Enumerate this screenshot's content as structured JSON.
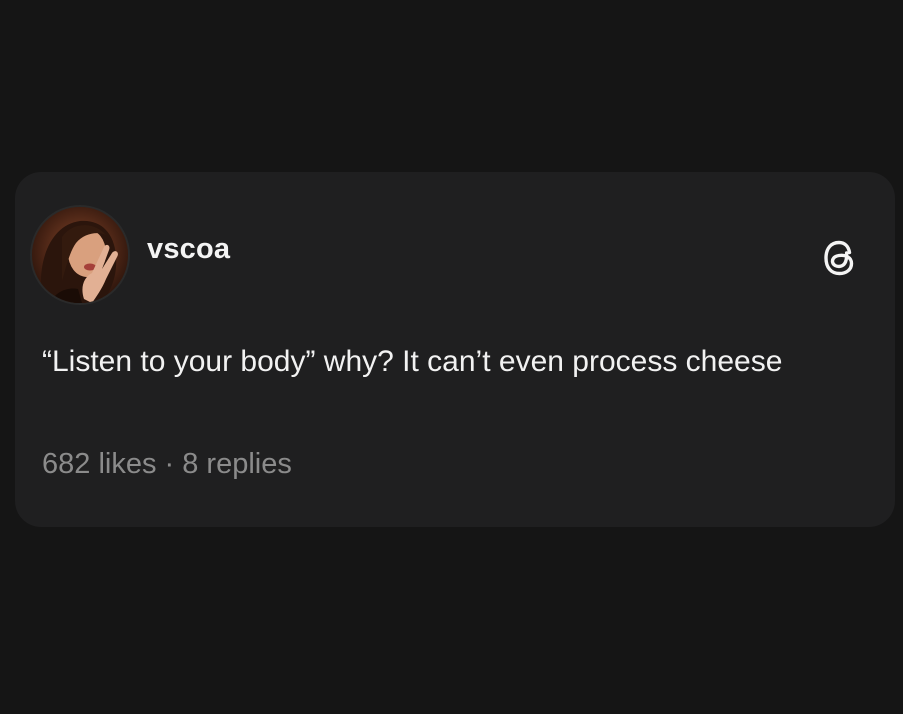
{
  "post": {
    "username": "vscoa",
    "text": "“Listen to your body” why? It can’t even process cheese",
    "likes": "682 likes",
    "separator": " · ",
    "replies": "8 replies",
    "avatar_icon": "user-avatar",
    "brand_icon": "threads-logo-icon"
  },
  "colors": {
    "background": "#151515",
    "card": "#1f1f20",
    "text": "#f2f2f2",
    "muted": "#8b8b8b"
  }
}
